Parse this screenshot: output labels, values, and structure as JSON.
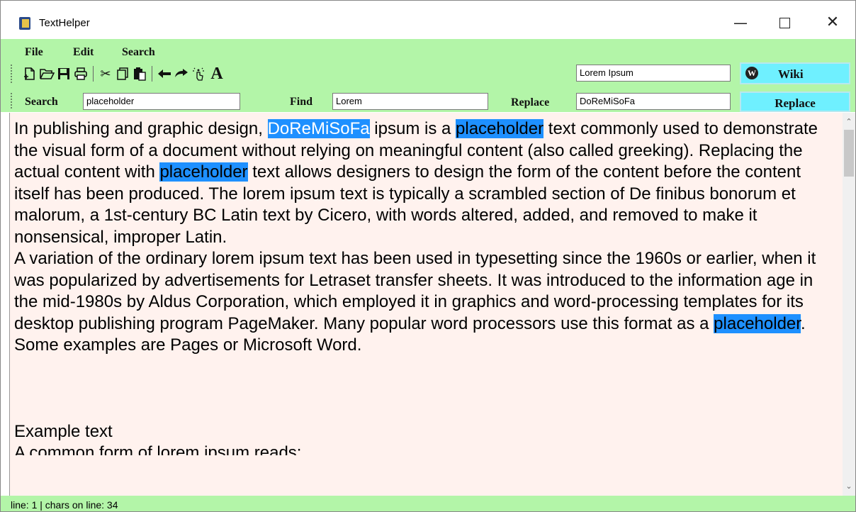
{
  "window": {
    "title": "TextHelper"
  },
  "menu": [
    "File",
    "Edit",
    "Search"
  ],
  "toolbar_icons": [
    "new-file-icon",
    "open-folder-icon",
    "save-icon",
    "print-icon",
    "cut-icon",
    "copy-icon",
    "paste-icon",
    "undo-icon",
    "redo-icon",
    "gesture-icon",
    "font-icon"
  ],
  "font_icon_glyph": "A",
  "wiki": {
    "value": "Lorem Ipsum",
    "button": "Wiki",
    "icon_glyph": "W"
  },
  "search": {
    "label": "Search",
    "value": "placeholder"
  },
  "find": {
    "label": "Find",
    "value": "Lorem"
  },
  "replace": {
    "label": "Replace",
    "value": "DoReMiSoFa",
    "button": "Replace"
  },
  "editor": {
    "p1": {
      "a": "In publishing and graphic design, ",
      "b": "DoReMiSoFa",
      "c": " ipsum is a ",
      "d": "placeholder",
      "e": " text commonly used to demonstrate the visual form of a document without relying on meaningful content (also called greeking). Replacing the actual content with ",
      "f": "placeholder",
      "g": " text allows designers to design the form of the content before the content itself has been produced. The lorem ipsum text is typically a scrambled section of De finibus bonorum et malorum, a 1st-century BC Latin text by Cicero, with words altered, added, and removed to make it nonsensical, improper Latin."
    },
    "p2": {
      "a": "A variation of the ordinary lorem ipsum text has been used in typesetting since the 1960s or earlier, when it was popularized by advertisements for Letraset transfer sheets. It was introduced to the information age in the mid-1980s by Aldus Corporation, which employed it in graphics and word-processing templates for its desktop publishing program PageMaker. Many popular word processors use this format as a ",
      "b": "placeholder",
      "c": ". Some examples are Pages or Microsoft Word."
    },
    "p3": "Example text",
    "p4": "A common form of lorem ipsum reads:"
  },
  "status": "line: 1 | chars on line: 34",
  "colors": {
    "toolbar_bg": "#b3f5a8",
    "editor_bg": "#fff2ee",
    "highlight": "#1e90ff",
    "button_bg": "#6ff0ff"
  }
}
